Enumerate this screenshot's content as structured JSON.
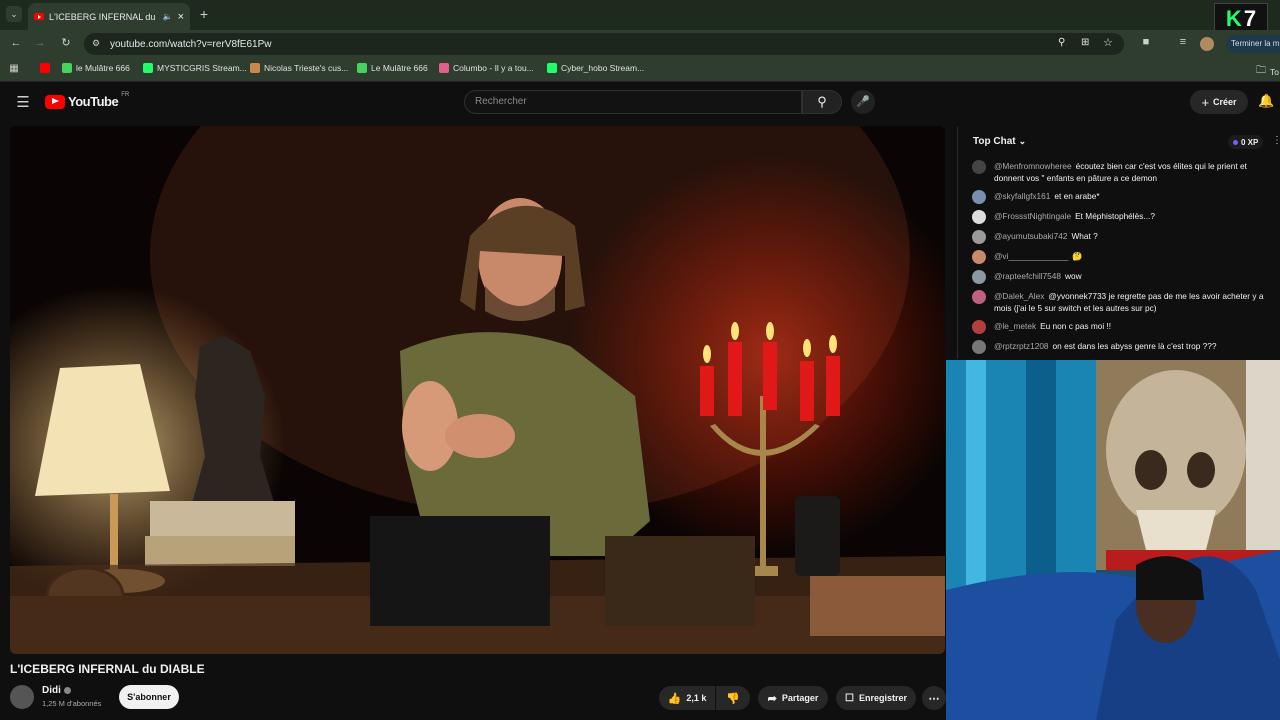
{
  "browser": {
    "tab_title": "L'ICEBERG INFERNAL du DIABLE",
    "url": "youtube.com/watch?v=rerV8fE61Pw",
    "profile_action": "Terminer la m",
    "bookmarks": [
      {
        "label": "",
        "color": "#ff0000"
      },
      {
        "label": "le Mulâtre 666",
        "color": "#46d160"
      },
      {
        "label": "MYSTICGRIS Stream...",
        "color": "#1eff6a"
      },
      {
        "label": "Nicolas Trieste's cus...",
        "color": "#c88a4a"
      },
      {
        "label": "Le Mulâtre 666",
        "color": "#46d160"
      },
      {
        "label": "Columbo - Il y a tou...",
        "color": "#e0608a"
      },
      {
        "label": "Cyber_hobo Stream...",
        "color": "#1eff6a"
      }
    ],
    "bookmarks_end": "To"
  },
  "overlay": {
    "k": "K",
    "n": "7"
  },
  "youtube": {
    "logo": "YouTube",
    "region": "FR",
    "search_placeholder": "Rechercher",
    "create_label": "Créer"
  },
  "video": {
    "title": "L'ICEBERG INFERNAL du DIABLE",
    "channel": "Didi",
    "subscribers": "1,25 M d'abonnés",
    "subscribe_label": "S'abonner",
    "likes": "2,1 k",
    "share_label": "Partager",
    "save_label": "Enregistrer"
  },
  "chat": {
    "mode": "Top Chat",
    "xp": "0 XP",
    "messages": [
      {
        "author": "@Menfromnowheree",
        "text": "écoutez bien car c'est vos élites qui le prient et donnent vos \" enfants en pâture a ce demon"
      },
      {
        "author": "@skyfallgfx161",
        "text": "et en arabe*"
      },
      {
        "author": "@FrossstNightingale",
        "text": "Et Méphistophélès...?"
      },
      {
        "author": "@ayumutsubaki742",
        "text": "What ?"
      },
      {
        "author": "@vi_____________",
        "text": "🤔"
      },
      {
        "author": "@rapteefchill7548",
        "text": "wow"
      },
      {
        "author": "@Dalek_Alex",
        "text": "@yvonnek7733 je regrette pas de me les avoir acheter y a mois (j'ai le 5 sur switch et les autres sur pc)"
      },
      {
        "author": "@le_metek",
        "text": "Eu non c pas moi !!"
      },
      {
        "author": "@rptzrptz1208",
        "text": "on est dans les abyss genre là c'est trop ???"
      }
    ]
  }
}
